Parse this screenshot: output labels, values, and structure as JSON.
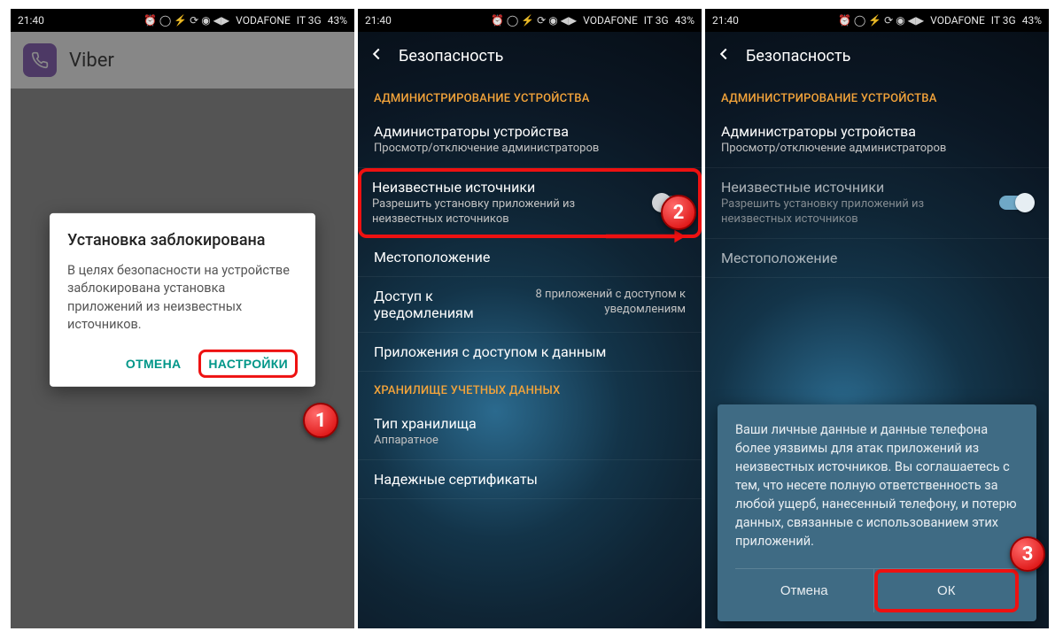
{
  "status": {
    "time": "21:40",
    "icons": "⏰ ◯ ⚡ ⟳ ◉ ◀▶",
    "carrier": "VODAFONE",
    "net": "IT 3G",
    "battery": "43%"
  },
  "screen1": {
    "app_name": "Viber",
    "dialog_title": "Установка заблокирована",
    "dialog_body": "В целях безопасности на устройстве заблокирована установка приложений из неизвестных источников.",
    "cancel": "ОТМЕНА",
    "settings": "НАСТРОЙКИ"
  },
  "settings": {
    "title": "Безопасность",
    "section_admin": "АДМИНИСТРИРОВАНИЕ УСТРОЙСТВА",
    "row_admins_title": "Администраторы устройства",
    "row_admins_sub": "Просмотр/отключение администраторов",
    "row_unknown_title": "Неизвестные источники",
    "row_unknown_sub": "Разрешить установку приложений из неизвестных источников",
    "row_location_title": "Местоположение",
    "row_notif_title": "Доступ к уведомлениям",
    "row_notif_right": "8 приложений с доступом к уведомлениям",
    "row_appdata_title": "Приложения с доступом к данным",
    "section_storage": "ХРАНИЛИЩЕ УЧЕТНЫХ ДАННЫХ",
    "row_storagetype_title": "Тип хранилища",
    "row_storagetype_sub": "Аппаратное",
    "row_certs_title": "Надежные сертификаты"
  },
  "warn": {
    "body": "Ваши личные данные и данные телефона более уязвимы для атак приложений из неизвестных источников. Вы соглашаетесь с тем, что несете полную ответственность за любой ущерб, нанесенный телефону, и потерю данных, связанные с использованием этих приложений.",
    "cancel": "Отмена",
    "ok": "ОК"
  },
  "badges": {
    "one": "1",
    "two": "2",
    "three": "3"
  }
}
